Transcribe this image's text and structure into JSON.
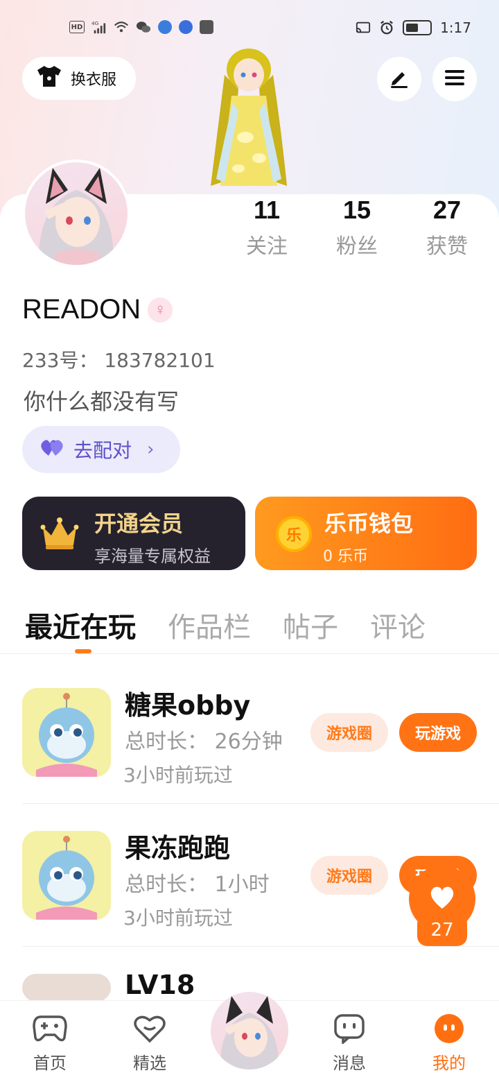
{
  "status_bar": {
    "time": "1:17",
    "network": "4G",
    "hd": "HD"
  },
  "header": {
    "outfit_label": "换衣服",
    "edit_icon": "edit-icon",
    "menu_icon": "menu-icon"
  },
  "stats": [
    {
      "value": "11",
      "label": "关注"
    },
    {
      "value": "15",
      "label": "粉丝"
    },
    {
      "value": "27",
      "label": "获赞"
    }
  ],
  "profile": {
    "username": "READON",
    "gender_symbol": "♀",
    "uid_label": "233号： 183782101",
    "bio": "你什么都没有写",
    "match_label": "去配对",
    "match_chevron": "›"
  },
  "vip": {
    "title": "开通会员",
    "subtitle": "享海量专属权益"
  },
  "wallet": {
    "title": "乐币钱包",
    "subtitle": "0 乐币",
    "coin_char": "乐"
  },
  "tabs": [
    {
      "label": "最近在玩",
      "active": true
    },
    {
      "label": "作品栏",
      "active": false
    },
    {
      "label": "帖子",
      "active": false
    },
    {
      "label": "评论",
      "active": false
    }
  ],
  "games": [
    {
      "name": "糖果obby",
      "total_time": "总时长： 26分钟",
      "last_played": "3小时前玩过",
      "circle_label": "游戏圈",
      "play_label": "玩游戏"
    },
    {
      "name": "果冻跑跑",
      "total_time": "总时长： 1小时",
      "last_played": "3小时前玩过",
      "circle_label": "游戏圈",
      "play_label": "玩游戏"
    },
    {
      "name": "LV18"
    }
  ],
  "like_fab": {
    "count": "27"
  },
  "bottom_nav": [
    {
      "label": "首页",
      "icon": "gamepad-icon"
    },
    {
      "label": "精选",
      "icon": "heart-chat-icon"
    },
    {
      "label": "",
      "icon": "avatar"
    },
    {
      "label": "消息",
      "icon": "message-icon"
    },
    {
      "label": "我的",
      "icon": "profile-icon",
      "active": true
    }
  ],
  "colors": {
    "accent": "#ff7315",
    "vip_bg": "#25222e",
    "vip_gold": "#f3d38b",
    "match_bg": "#ecebfb",
    "match_text": "#5b50c8"
  }
}
